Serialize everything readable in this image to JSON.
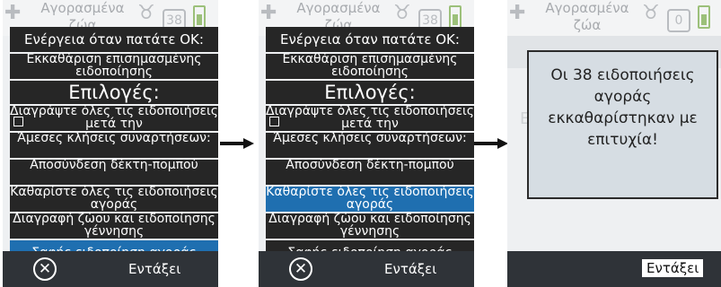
{
  "header": {
    "title": "Αγορασμένα ζώα",
    "count": "38",
    "count_done": "0"
  },
  "menu": {
    "heading": "Ενέργεια όταν πατάτε ΟΚ:",
    "items": [
      {
        "label": "Εκκαθάριση επισημασμένης ειδοποίησης"
      },
      {
        "label": "Επιλογές:"
      },
      {
        "label": "Διαγράψτε όλες τις ειδοποιήσεις μετά την"
      },
      {
        "label": "Άμεσες κλήσεις συναρτήσεων:"
      },
      {
        "label": "Αποσύνδεση δέκτη-πομπού"
      },
      {
        "label": "Καθαρίστε όλες τις ειδοποιήσεις αγοράς"
      },
      {
        "label": "Διαγραφή ζώου και ειδοποίησης γέννησης"
      },
      {
        "label": "Σαφής ειδοποίηση αγοράς"
      }
    ]
  },
  "footer": {
    "cancel_icon": "close-circle-icon",
    "ok_label": "Εντάξει"
  },
  "dialog": {
    "message": "Οι 38 ειδοποιήσεις αγοράς εκκαθαρίστηκαν με επιτυχία!"
  },
  "background_text": {
    "left": "Ε",
    "right": "ς!"
  },
  "colors": {
    "selected": "#1f6fb0",
    "menu_row": "#262626",
    "footer": "#2f3338"
  }
}
